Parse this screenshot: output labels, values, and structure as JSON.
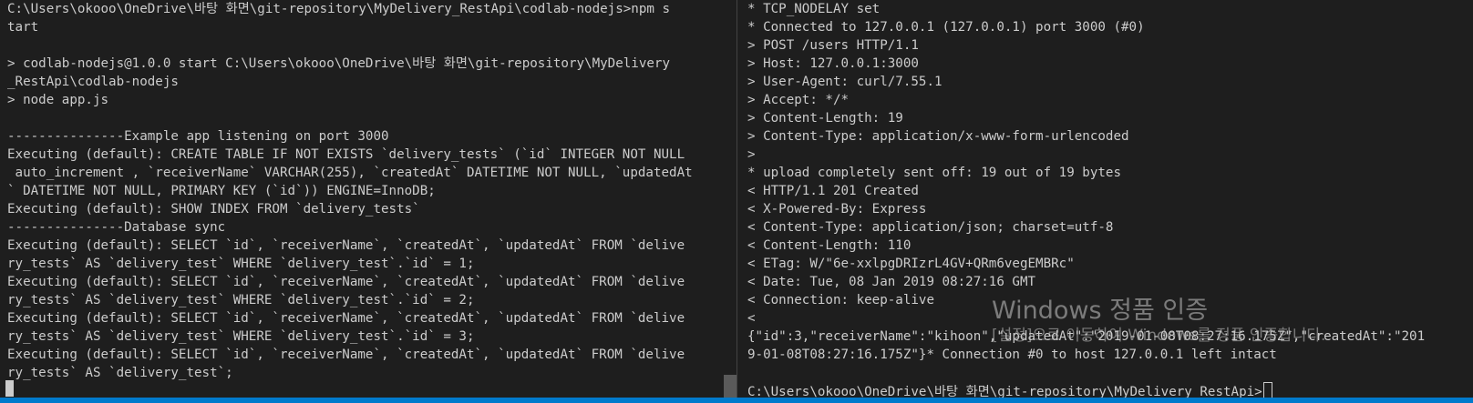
{
  "left_terminal": {
    "lines": [
      "C:\\Users\\okooo\\OneDrive\\바탕 화면\\git-repository\\MyDelivery_RestApi\\codlab-nodejs>npm s",
      "tart",
      "",
      "> codlab-nodejs@1.0.0 start C:\\Users\\okooo\\OneDrive\\바탕 화면\\git-repository\\MyDelivery",
      "_RestApi\\codlab-nodejs",
      "> node app.js",
      "",
      "---------------Example app listening on port 3000",
      "Executing (default): CREATE TABLE IF NOT EXISTS `delivery_tests` (`id` INTEGER NOT NULL",
      " auto_increment , `receiverName` VARCHAR(255), `createdAt` DATETIME NOT NULL, `updatedAt",
      "` DATETIME NOT NULL, PRIMARY KEY (`id`)) ENGINE=InnoDB;",
      "Executing (default): SHOW INDEX FROM `delivery_tests`",
      "---------------Database sync",
      "Executing (default): SELECT `id`, `receiverName`, `createdAt`, `updatedAt` FROM `delive",
      "ry_tests` AS `delivery_test` WHERE `delivery_test`.`id` = 1;",
      "Executing (default): SELECT `id`, `receiverName`, `createdAt`, `updatedAt` FROM `delive",
      "ry_tests` AS `delivery_test` WHERE `delivery_test`.`id` = 2;",
      "Executing (default): SELECT `id`, `receiverName`, `createdAt`, `updatedAt` FROM `delive",
      "ry_tests` AS `delivery_test` WHERE `delivery_test`.`id` = 3;",
      "Executing (default): SELECT `id`, `receiverName`, `createdAt`, `updatedAt` FROM `delive",
      "ry_tests` AS `delivery_test`;"
    ]
  },
  "right_terminal": {
    "lines": [
      "* TCP_NODELAY set",
      "* Connected to 127.0.0.1 (127.0.0.1) port 3000 (#0)",
      "> POST /users HTTP/1.1",
      "> Host: 127.0.0.1:3000",
      "> User-Agent: curl/7.55.1",
      "> Accept: */*",
      "> Content-Length: 19",
      "> Content-Type: application/x-www-form-urlencoded",
      ">",
      "* upload completely sent off: 19 out of 19 bytes",
      "< HTTP/1.1 201 Created",
      "< X-Powered-By: Express",
      "< Content-Type: application/json; charset=utf-8",
      "< Content-Length: 110",
      "< ETag: W/\"6e-xxlpgDRIzrL4GV+QRm6vegEMBRc\"",
      "< Date: Tue, 08 Jan 2019 08:27:16 GMT",
      "< Connection: keep-alive",
      "<",
      "{\"id\":3,\"receiverName\":\"kihoon\",\"updatedAt\":\"2019-01-08T08:27:16.175Z\",\"createdAt\":\"201",
      "9-01-08T08:27:16.175Z\"}* Connection #0 to host 127.0.0.1 left intact",
      ""
    ],
    "prompt": "C:\\Users\\okooo\\OneDrive\\바탕 화면\\git-repository\\MyDelivery_RestApi>"
  },
  "watermark": {
    "title": "Windows 정품 인증",
    "subtitle": "[설정]으로 이동하여 Windows를 정품 인증합니다."
  },
  "colors": {
    "background": "#1e1e1e",
    "text": "#cccccc",
    "accent_bar": "#007acc",
    "scroll_thumb": "#5a5a5a"
  }
}
